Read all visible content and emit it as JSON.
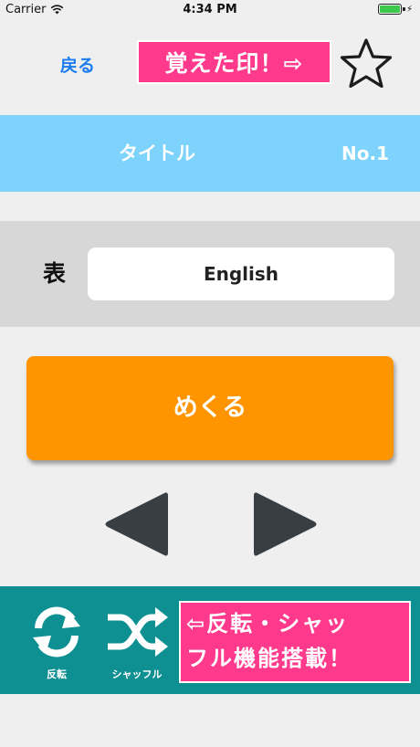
{
  "status_bar": {
    "carrier": "Carrier",
    "time": "4:34 PM",
    "battery_percent": 100
  },
  "header": {
    "back_label": "戻る",
    "marked_banner": "覚えた印！⇨",
    "star_icon": "star-outline-icon"
  },
  "title_band": {
    "title": "タイトル",
    "number": "No.1"
  },
  "face": {
    "label": "表",
    "value": "English"
  },
  "flip_button": {
    "label": "めくる"
  },
  "navigation": {
    "prev_icon": "triangle-left-icon",
    "next_icon": "triangle-right-icon"
  },
  "bottom_bar": {
    "reverse_label": "反転",
    "shuffle_label": "シャッフル",
    "feature_line1": "⇦反転・シャッ",
    "feature_line2": "フル機能搭載！"
  },
  "colors": {
    "background": "#efefef",
    "link_blue": "#1b7cf0",
    "pink_banner": "#ff3a8c",
    "title_band": "#7dd3fb",
    "face_band": "#d7d7d7",
    "flip_orange": "#fe9500",
    "arrow_dark": "#383e44",
    "bottom_teal": "#0e8f91"
  }
}
